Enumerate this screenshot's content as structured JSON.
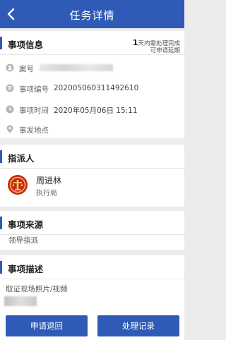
{
  "header": {
    "title": "任务详情",
    "back_icon": "back-chevron-icon"
  },
  "info": {
    "heading": "事项信息",
    "deadline_number": "1",
    "deadline_line1": "天内需处理完成",
    "deadline_line2": "可申请延期",
    "case_label": "案号",
    "id_label": "事项编号",
    "id_value": "202005060311492610",
    "time_label": "事项时间",
    "time_value": "2020年05月06日 15:11",
    "location_label": "事发地点"
  },
  "assignee": {
    "heading": "指派人",
    "name": "周进林",
    "org": "执行局"
  },
  "source": {
    "heading": "事项来源",
    "value": "领导指派"
  },
  "description": {
    "heading": "事项描述",
    "text": "取证现场照片/视频"
  },
  "actions": {
    "return_label": "申请退回",
    "records_label": "处理记录"
  },
  "colors": {
    "primary": "#2f5bb7",
    "background": "#ececec",
    "emblem": "#c8281e"
  }
}
